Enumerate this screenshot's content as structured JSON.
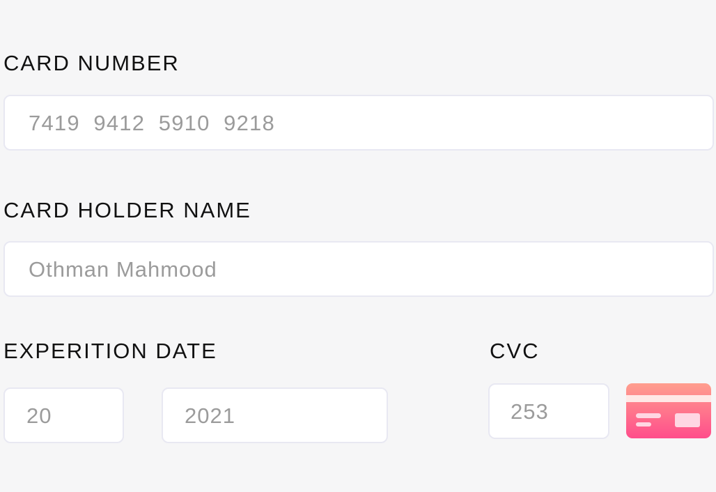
{
  "card_number": {
    "label": "CARD NUMBER",
    "value": "7419  9412  5910  9218"
  },
  "card_holder": {
    "label": "CARD HOLDER NAME",
    "value": "Othman Mahmood"
  },
  "expiration": {
    "label": "EXPERITION DATE",
    "month": "20",
    "year": "2021"
  },
  "cvc": {
    "label": "CVC",
    "value": "253"
  },
  "icons": {
    "card": "credit-card-icon"
  },
  "colors": {
    "background": "#f6f6f7",
    "field_border": "#e8e8f2",
    "field_text": "#9b9b9b",
    "label_text": "#111111",
    "card_top": "#ff9a8b",
    "card_bottom": "#ff4e8a"
  }
}
